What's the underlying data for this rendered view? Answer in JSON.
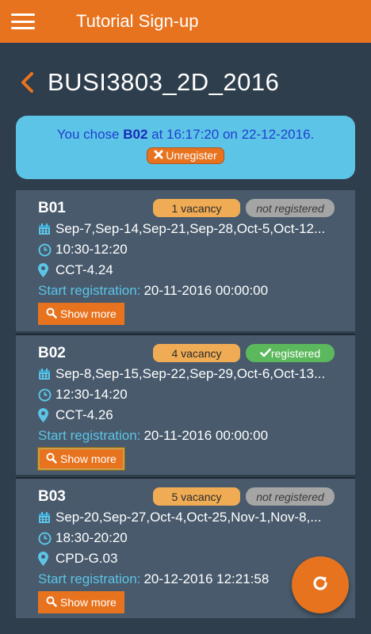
{
  "appbar": {
    "title": "Tutorial Sign-up"
  },
  "page": {
    "title": "BUSI3803_2D_2016"
  },
  "banner": {
    "prefix": "You chose ",
    "chosen": "B02",
    "suffix": " at 16:17:20 on 22-12-2016.",
    "unregister_label": "Unregister"
  },
  "sessions": [
    {
      "code": "B01",
      "vacancy": "1 vacancy",
      "status": "not registered",
      "dates": "Sep-7,Sep-14,Sep-21,Sep-28,Oct-5,Oct-12...",
      "time": "10:30-12:20",
      "location": "CCT-4.24",
      "start_label": "Start registration:",
      "start_value": "20-11-2016 00:00:00",
      "show_more": "Show more"
    },
    {
      "code": "B02",
      "vacancy": "4 vacancy",
      "status": "registered",
      "dates": "Sep-8,Sep-15,Sep-22,Sep-29,Oct-6,Oct-13...",
      "time": "12:30-14:20",
      "location": "CCT-4.26",
      "start_label": "Start registration:",
      "start_value": "20-11-2016 00:00:00",
      "show_more": "Show more"
    },
    {
      "code": "B03",
      "vacancy": "5 vacancy",
      "status": "not registered",
      "dates": "Sep-20,Sep-27,Oct-4,Oct-25,Nov-1,Nov-8,...",
      "time": "18:30-20:20",
      "location": "CPD-G.03",
      "start_label": "Start registration:",
      "start_value": "20-12-2016 12:21:58",
      "show_more": "Show more"
    }
  ],
  "icons": {
    "menu": "hamburger-menu-icon",
    "back": "chevron-left-icon",
    "unregister": "times-icon",
    "calendar": "calendar-icon",
    "clock": "clock-icon",
    "location": "map-marker-icon",
    "search": "search-icon",
    "registered": "check-icon",
    "refresh": "refresh-icon"
  },
  "colors": {
    "accent": "#e8731f",
    "background": "#2f3e4d",
    "card": "#485a6c",
    "banner": "#5cc4e6",
    "banner_text": "#1f3fd1",
    "vacancy_badge": "#f0ac55",
    "registered_badge": "#5cb85c",
    "not_registered_badge": "#a5a5a5",
    "label_blue": "#5cc4e6"
  }
}
